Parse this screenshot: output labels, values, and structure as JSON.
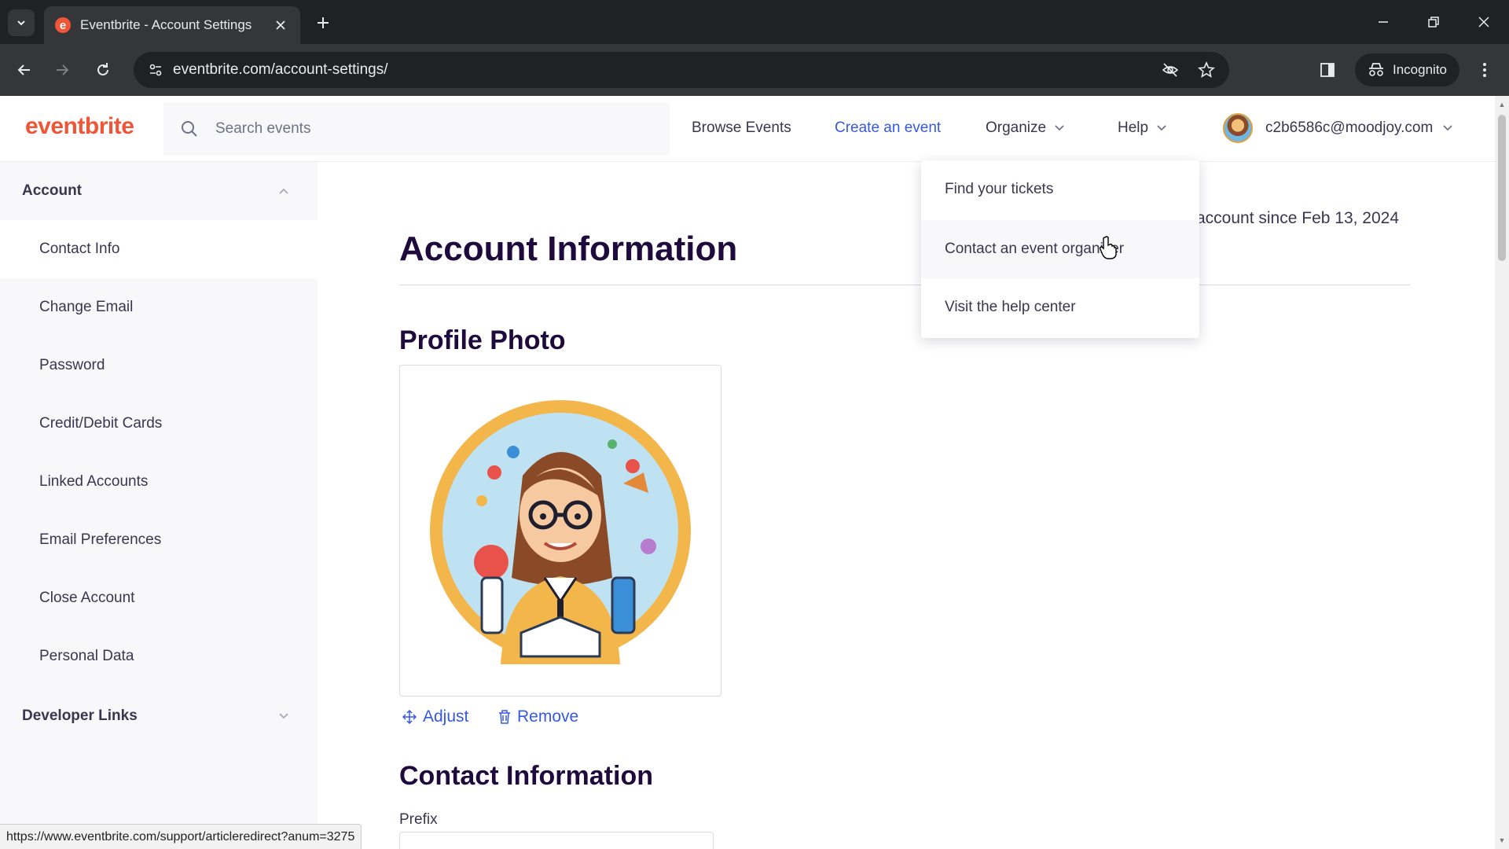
{
  "browser": {
    "tab_title": "Eventbrite - Account Settings",
    "tab_favicon": "e",
    "url": "eventbrite.com/account-settings/",
    "incognito_label": "Incognito",
    "status_url": "https://www.eventbrite.com/support/articleredirect?anum=3275"
  },
  "header": {
    "logo": "eventbrite",
    "search_placeholder": "Search events",
    "browse_events": "Browse Events",
    "create_event": "Create an event",
    "organize": "Organize",
    "help": "Help",
    "user_email": "c2b6586c@moodjoy.com"
  },
  "help_menu": {
    "items": [
      "Find your tickets",
      "Contact an event organizer",
      "Visit the help center"
    ]
  },
  "sidebar": {
    "account_section": "Account",
    "items": [
      "Contact Info",
      "Change Email",
      "Password",
      "Credit/Debit Cards",
      "Linked Accounts",
      "Email Preferences",
      "Close Account",
      "Personal Data"
    ],
    "developer_section": "Developer Links"
  },
  "main": {
    "account_since": "account since Feb 13, 2024",
    "title": "Account Information",
    "profile_photo_heading": "Profile Photo",
    "adjust_label": "Adjust",
    "remove_label": "Remove",
    "contact_heading": "Contact Information",
    "prefix_label": "Prefix"
  },
  "colors": {
    "brand": "#f05537",
    "link": "#3659e3",
    "heading": "#1e0a3c"
  }
}
